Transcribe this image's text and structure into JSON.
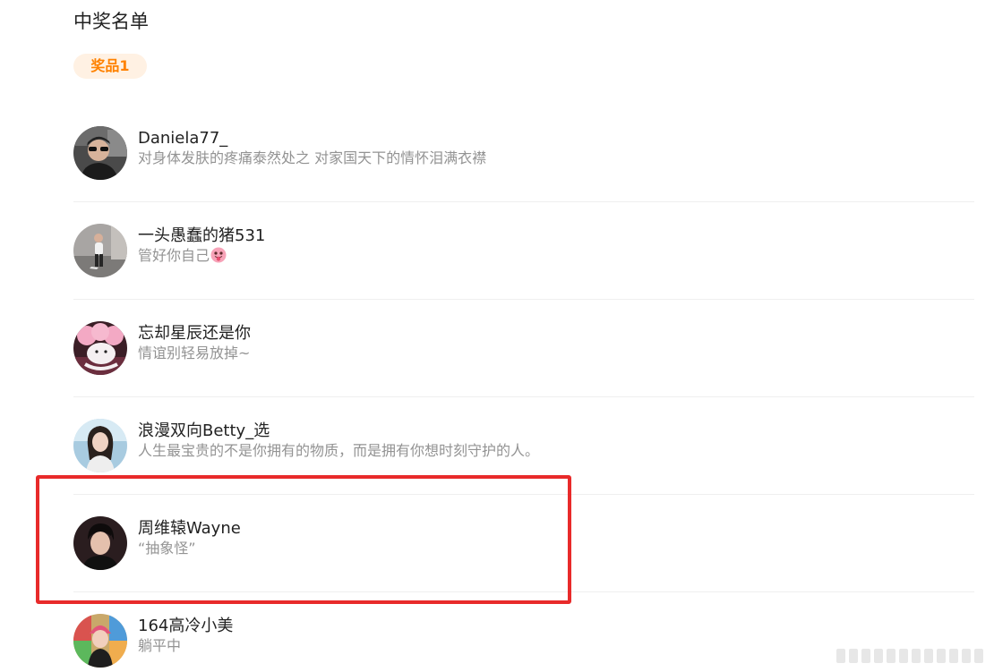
{
  "page": {
    "title": "中奖名单",
    "prize_tab": "奖品1"
  },
  "winners": [
    {
      "name": "Daniela77_",
      "bio": "对身体发肤的疼痛泰然处之 对家国天下的情怀泪满衣襟",
      "avatar_icon": "user-avatar-man-sunglasses"
    },
    {
      "name": "一头愚蠢的猪531",
      "bio": "管好你自己",
      "bio_emoji": "tongue-out-emoji-icon",
      "avatar_icon": "user-avatar-street-photo"
    },
    {
      "name": "忘却星辰还是你",
      "bio": "情谊别轻易放掉~",
      "avatar_icon": "user-avatar-pink-cartoon"
    },
    {
      "name": "浪漫双向Betty_选",
      "bio": "人生最宝贵的不是你拥有的物质，而是拥有你想时刻守护的人。",
      "avatar_icon": "user-avatar-woman"
    },
    {
      "name": "周维辕Wayne",
      "bio": "“抽象怪”",
      "avatar_icon": "user-avatar-young-man",
      "highlighted": true
    },
    {
      "name": "164高冷小美",
      "bio": "躺平中",
      "avatar_icon": "user-avatar-colorful-photo"
    }
  ],
  "colors": {
    "prize_accent": "#ff8200",
    "prize_badge_bg": "#fff1e3",
    "highlight_border": "#e82a2a",
    "name_text": "#222222",
    "bio_text": "#939393"
  }
}
